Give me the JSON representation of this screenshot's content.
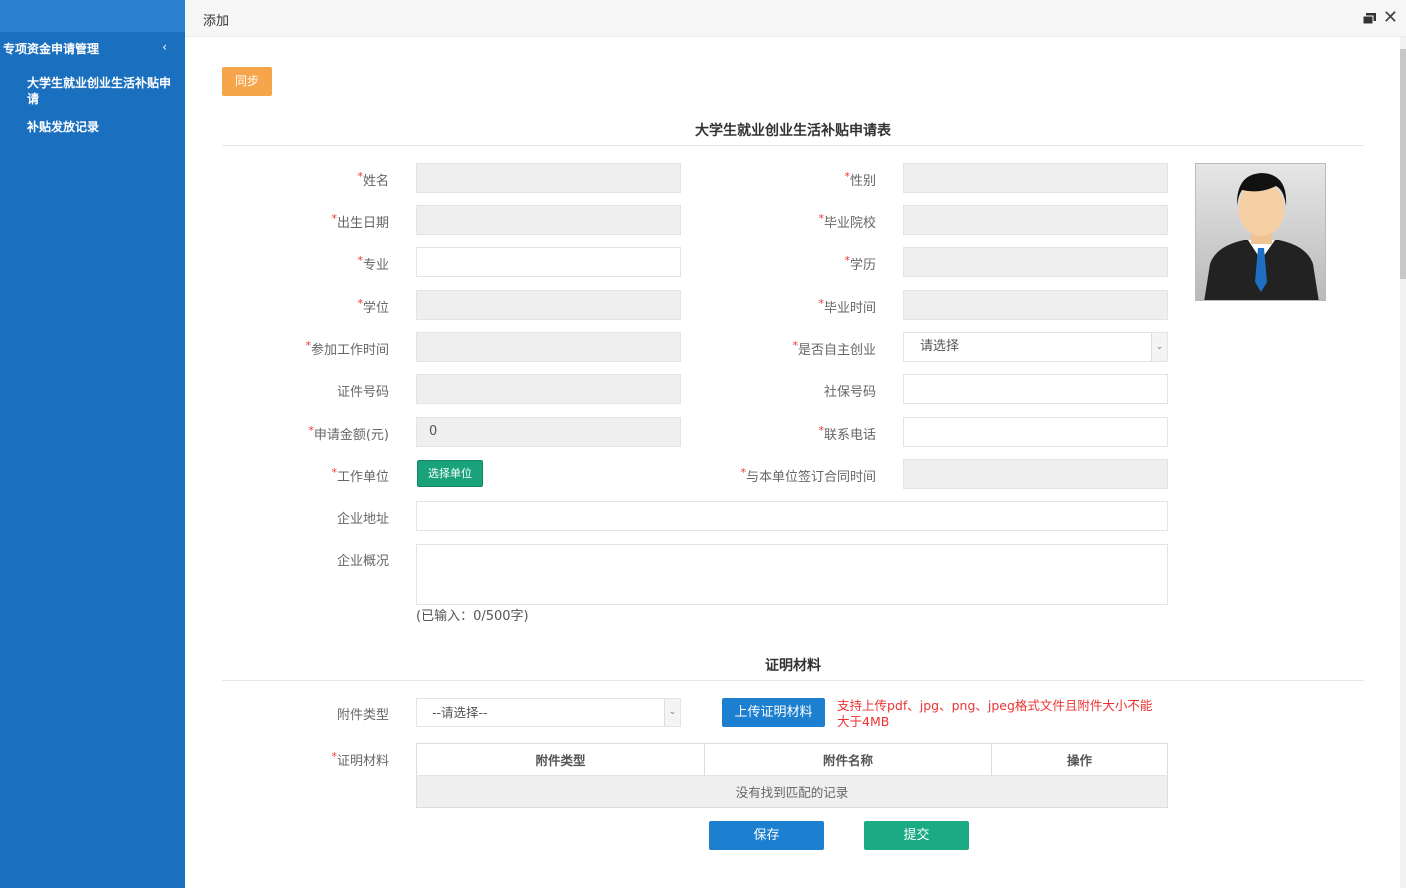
{
  "sidebar": {
    "group_label": "专项资金申请管理",
    "group_chevron": "‹",
    "items": [
      {
        "label": "大学生就业创业生活补贴申请"
      },
      {
        "label": "补贴发放记录"
      }
    ]
  },
  "modal": {
    "title": "添加",
    "maximize_icon": "restore-icon",
    "close_icon": "close-icon",
    "close_glyph": "✕"
  },
  "toolbar": {
    "sync_label": "同步"
  },
  "form": {
    "title": "大学生就业创业生活补贴申请表",
    "required_mark": "*",
    "labels": {
      "name": "姓名",
      "gender": "性别",
      "birth_date": "出生日期",
      "school": "毕业院校",
      "major": "专业",
      "education": "学历",
      "degree": "学位",
      "grad_time": "毕业时间",
      "work_start": "参加工作时间",
      "self_employed": "是否自主创业",
      "id_number": "证件号码",
      "social_security": "社保号码",
      "amount": "申请金额(元)",
      "phone": "联系电话",
      "employer": "工作单位",
      "contract_time": "与本单位签订合同时间",
      "company_address": "企业地址",
      "company_overview": "企业概况"
    },
    "values": {
      "amount": "0",
      "self_employed_selected": "请选择"
    },
    "pick_employer_label": "选择单位",
    "char_counter": "(已输入：0/500字)"
  },
  "proof": {
    "section_title": "证明材料",
    "attachment_type_label": "附件类型",
    "attachment_type_selected": "--请选择--",
    "upload_label": "上传证明材料",
    "upload_hint": "支持上传pdf、jpg、png、jpeg格式文件且附件大小不能大于4MB",
    "materials_label": "证明材料",
    "table": {
      "headers": [
        "附件类型",
        "附件名称",
        "操作"
      ],
      "empty_text": "没有找到匹配的记录"
    }
  },
  "actions": {
    "save_label": "保存",
    "submit_label": "提交"
  },
  "colors": {
    "sidebar_bg": "#1a6fbf",
    "sync_button": "#f7a54a",
    "primary_button": "#1d7fcf",
    "success_button": "#1aab84",
    "required": "#e33333"
  }
}
